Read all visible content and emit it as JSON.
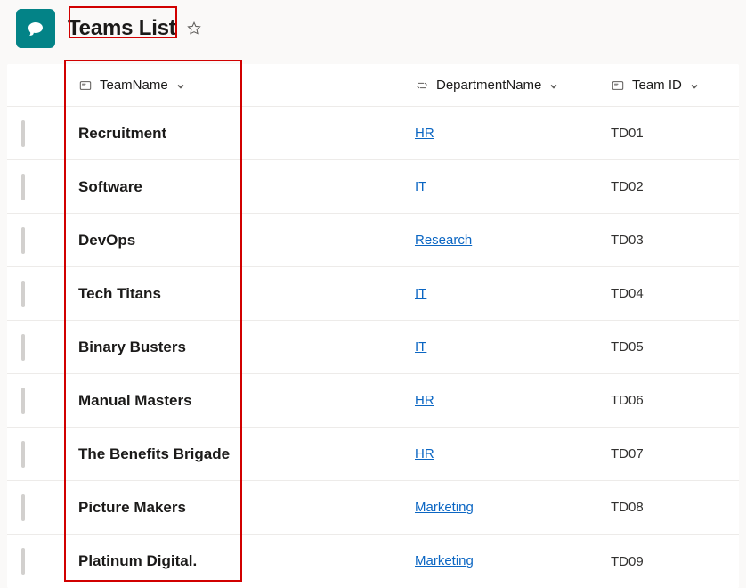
{
  "header": {
    "page_title": "Teams List"
  },
  "columns": {
    "team_name": "TeamName",
    "department_name": "DepartmentName",
    "team_id": "Team ID"
  },
  "rows": [
    {
      "team_name": "Recruitment",
      "department": "HR",
      "team_id": "TD01"
    },
    {
      "team_name": "Software",
      "department": "IT",
      "team_id": "TD02"
    },
    {
      "team_name": "DevOps",
      "department": "Research",
      "team_id": "TD03"
    },
    {
      "team_name": "Tech Titans",
      "department": "IT",
      "team_id": "TD04"
    },
    {
      "team_name": "Binary Busters",
      "department": "IT",
      "team_id": "TD05"
    },
    {
      "team_name": "Manual Masters",
      "department": "HR",
      "team_id": "TD06"
    },
    {
      "team_name": "The Benefits Brigade",
      "department": "HR",
      "team_id": "TD07"
    },
    {
      "team_name": "Picture Makers",
      "department": "Marketing",
      "team_id": "TD08"
    },
    {
      "team_name": "Platinum Digital.",
      "department": "Marketing",
      "team_id": "TD09"
    }
  ]
}
